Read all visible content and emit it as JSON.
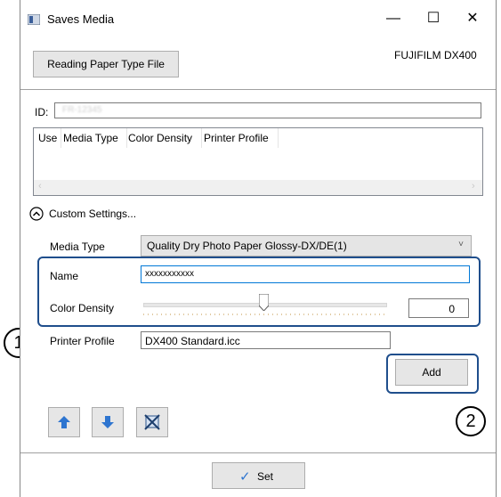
{
  "window": {
    "title": "Saves Media",
    "minimize_glyph": "—",
    "maximize_glyph": "☐",
    "close_glyph": "✕"
  },
  "header": {
    "reading_button": "Reading Paper Type File",
    "printer_model": "FUJIFILM DX400"
  },
  "id_field": {
    "label": "ID:",
    "value": "FR-12345"
  },
  "media_table": {
    "columns": [
      "Use",
      "Media Type",
      "Color Density",
      "Printer Profile"
    ]
  },
  "custom_settings": {
    "toggle_label": "Custom Settings...",
    "media_type_label": "Media Type",
    "media_type_value": "Quality Dry Photo Paper Glossy-DX/DE(1)",
    "name_label": "Name",
    "name_value": "xxxxxxxxxxx",
    "color_density_label": "Color Density",
    "color_density_value": "0",
    "color_density_slider": 0.5,
    "printer_profile_label": "Printer Profile",
    "printer_profile_value": "DX400 Standard.icc",
    "add_button": "Add"
  },
  "footer": {
    "set_button": "Set"
  },
  "callouts": {
    "one": "1",
    "two": "2"
  },
  "colors": {
    "highlight_outline": "#1f4e8c",
    "arrow_blue": "#2e75d0"
  }
}
